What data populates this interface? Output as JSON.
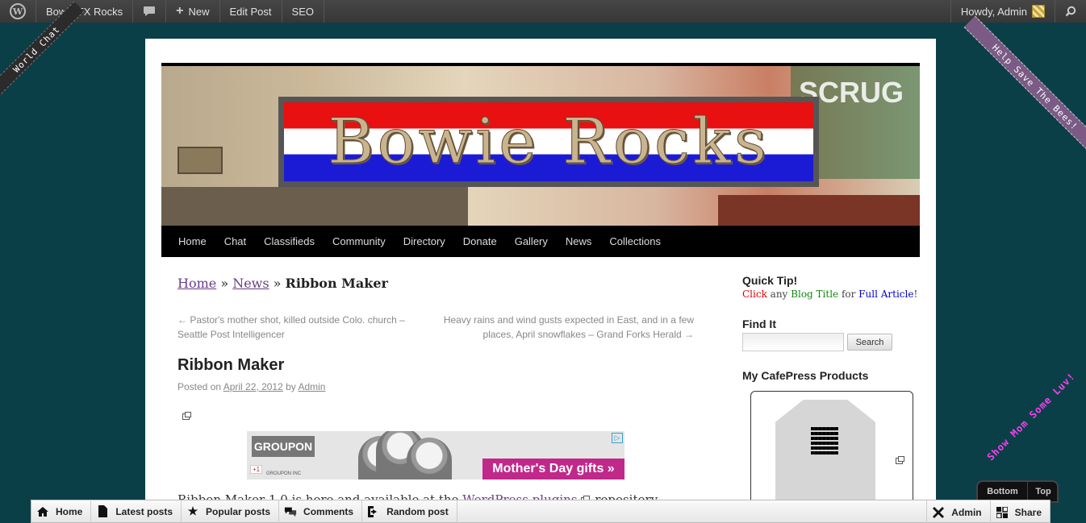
{
  "adminbar": {
    "wp_logo": "W",
    "site_name": "Bowie TX Rocks",
    "comments_icon": "speech-bubble-icon",
    "new_label": "New",
    "edit_post_label": "Edit Post",
    "seo_label": "SEO",
    "howdy": "Howdy, Admin"
  },
  "ribbons": {
    "left": "World Chat",
    "right": "Help Save The Bees!",
    "mom": "Show Mom Some Luv!"
  },
  "banner": {
    "logo_text": "Bowie Rocks",
    "sign_text": "SCRUG"
  },
  "nav": [
    "Home",
    "Chat",
    "Classifieds",
    "Community",
    "Directory",
    "Donate",
    "Gallery",
    "News",
    "Collections"
  ],
  "breadcrumb": {
    "home": "Home",
    "sep1": " » ",
    "news": "News",
    "sep2": " » ",
    "current": "Ribbon Maker"
  },
  "post_nav": {
    "prev": "← Pastor's mother shot, killed outside Colo. church – Seattle Post Intelligencer",
    "next": "Heavy rains and wind gusts expected in East, and in a few places, April snowflakes – Grand Forks Herald →"
  },
  "post": {
    "title": "Ribbon Maker",
    "posted_on": "Posted on ",
    "date": "April 22, 2012",
    "by": " by ",
    "author": "Admin",
    "body_start": "Ribbon Maker 1.0 is here and available at the ",
    "body_link": "WordPress plugins",
    "body_end": " repository"
  },
  "ad": {
    "brand": "GROUPON",
    "small": "GROUPON INC",
    "plus": "+1",
    "cta": "Mother's Day gifts »",
    "choices_icon": "adchoices-icon"
  },
  "sidebar": {
    "quick_tip_title": "Quick Tip!",
    "tip_click": "Click",
    "tip_any": " any ",
    "tip_blog_title": "Blog Title",
    "tip_for": " for ",
    "tip_full_article": "Full Article",
    "tip_end": "!",
    "find_it_title": "Find It",
    "search_button": "Search",
    "search_value": "",
    "cafepress_title": "My CafePress Products"
  },
  "scroller": {
    "bottom": "Bottom",
    "top": "Top"
  },
  "bottombar": {
    "items": [
      {
        "icon": "home-icon",
        "label": "Home"
      },
      {
        "icon": "document-icon",
        "label": "Latest posts"
      },
      {
        "icon": "star-icon",
        "label": "Popular posts"
      },
      {
        "icon": "comments-icon",
        "label": "Comments"
      },
      {
        "icon": "random-icon",
        "label": "Random post"
      }
    ],
    "admin": "Admin",
    "share": "Share"
  },
  "colors": {
    "background": "#0b3f48",
    "link_purple": "#6a3d8a",
    "tip_red": "#e00000",
    "tip_green": "#118811",
    "tip_blue": "#0000cc",
    "mom_pink": "#ff3df4",
    "groupon_cta": "#c0288a"
  }
}
